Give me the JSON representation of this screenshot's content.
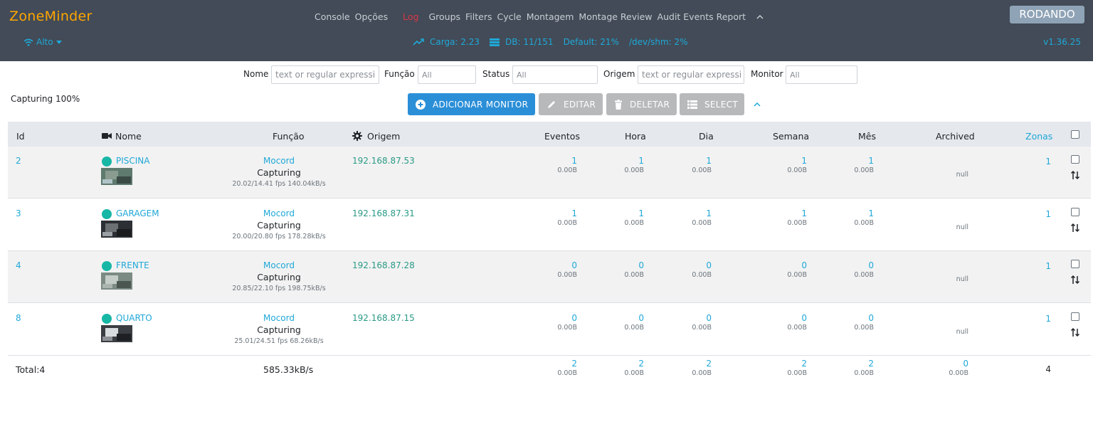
{
  "app": {
    "brand": "ZoneMinder",
    "status": "RODANDO",
    "version": "v1.36.25"
  },
  "menu": [
    "Console",
    "Opções",
    "Log",
    "Groups",
    "Filters",
    "Cycle",
    "Montagem",
    "Montage Review",
    "Audit Events Report"
  ],
  "bandwidth": {
    "label": "Alto",
    "icon": "wifi-icon"
  },
  "sysinfo": {
    "load": "Carga: 2.23",
    "db": "DB: 11/151",
    "disk": "Default: 21%",
    "shm": "/dev/shm: 2%"
  },
  "filters": {
    "nome_label": "Nome",
    "nome_placeholder": "text or regular expressi",
    "funcao_label": "Função",
    "funcao_value": "All",
    "status_label": "Status",
    "status_value": "All",
    "origem_label": "Origem",
    "origem_placeholder": "text or regular expressi",
    "monitor_label": "Monitor",
    "monitor_value": "All"
  },
  "capturing_note": "Capturing 100%",
  "buttons": {
    "add": "ADICIONAR MONITOR",
    "edit": "EDITAR",
    "delete": "DELETAR",
    "select": "SELECT"
  },
  "table": {
    "headers": {
      "id": "Id",
      "name": "Nome",
      "function": "Função",
      "source": "Origem",
      "events": "Eventos",
      "hour": "Hora",
      "day": "Dia",
      "week": "Semana",
      "month": "Mês",
      "archived": "Archived",
      "zones": "Zonas"
    },
    "rows": [
      {
        "id": "2",
        "name": "PISCINA",
        "function": "Mocord",
        "status": "Capturing",
        "fps": "20.02/14.41 fps 140.04kB/s",
        "source": "192.168.87.53",
        "events": "1",
        "events_size": "0.00B",
        "hour": "1",
        "hour_size": "0.00B",
        "day": "1",
        "day_size": "0.00B",
        "week": "1",
        "week_size": "0.00B",
        "month": "1",
        "month_size": "0.00B",
        "archived": "null",
        "zones": "1"
      },
      {
        "id": "3",
        "name": "GARAGEM",
        "function": "Mocord",
        "status": "Capturing",
        "fps": "20.00/20.80 fps 178.28kB/s",
        "source": "192.168.87.31",
        "events": "1",
        "events_size": "0.00B",
        "hour": "1",
        "hour_size": "0.00B",
        "day": "1",
        "day_size": "0.00B",
        "week": "1",
        "week_size": "0.00B",
        "month": "1",
        "month_size": "0.00B",
        "archived": "null",
        "zones": "1"
      },
      {
        "id": "4",
        "name": "FRENTE",
        "function": "Mocord",
        "status": "Capturing",
        "fps": "20.85/22.10 fps 198.75kB/s",
        "source": "192.168.87.28",
        "events": "0",
        "events_size": "0.00B",
        "hour": "0",
        "hour_size": "0.00B",
        "day": "0",
        "day_size": "0.00B",
        "week": "0",
        "week_size": "0.00B",
        "month": "0",
        "month_size": "0.00B",
        "archived": "null",
        "zones": "1"
      },
      {
        "id": "8",
        "name": "QUARTO",
        "function": "Mocord",
        "status": "Capturing",
        "fps": "25.01/24.51 fps 68.26kB/s",
        "source": "192.168.87.15",
        "events": "0",
        "events_size": "0.00B",
        "hour": "0",
        "hour_size": "0.00B",
        "day": "0",
        "day_size": "0.00B",
        "week": "0",
        "week_size": "0.00B",
        "month": "0",
        "month_size": "0.00B",
        "archived": "null",
        "zones": "1"
      }
    ],
    "total": {
      "label": "Total:4",
      "bandwidth": "585.33kB/s",
      "events": "2",
      "events_size": "0.00B",
      "hour": "2",
      "hour_size": "0.00B",
      "day": "2",
      "day_size": "0.00B",
      "week": "2",
      "week_size": "0.00B",
      "month": "2",
      "month_size": "0.00B",
      "archived": "0",
      "archived_size": "0.00B",
      "zones": "4"
    }
  },
  "colors": {
    "navbar": "#424b57",
    "brand": "#ffa500",
    "link": "#1fa8d8",
    "active_menu": "#dc3545",
    "primary_button": "#2b8fd8",
    "status_dot": "#17b7a6"
  }
}
